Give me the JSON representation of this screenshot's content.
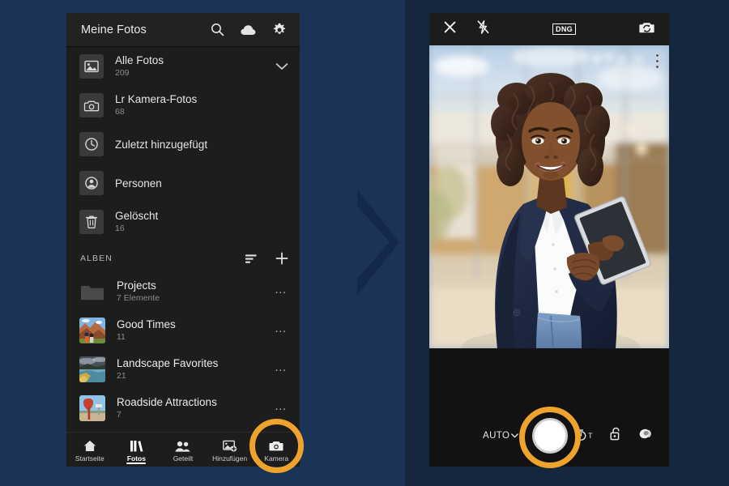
{
  "app": {
    "background_color": "#1a3356",
    "background_dark_color": "#16263d",
    "accent_color": "#eda32c"
  },
  "library": {
    "header": {
      "title": "Meine Fotos",
      "icons": [
        {
          "name": "search-icon",
          "label": "Suchen"
        },
        {
          "name": "cloud-icon",
          "label": "Cloud"
        },
        {
          "name": "gear-icon",
          "label": "Einstellungen"
        }
      ]
    },
    "categories": [
      {
        "name": "Alle Fotos",
        "count": "209",
        "icon": "photo-icon",
        "expandable": true
      },
      {
        "name": "Lr Kamera-Fotos",
        "count": "68",
        "icon": "camera-icon",
        "expandable": false
      },
      {
        "name": "Zuletzt hinzugefügt",
        "count": "",
        "icon": "clock-icon",
        "expandable": false
      },
      {
        "name": "Personen",
        "count": "",
        "icon": "person-icon",
        "expandable": false
      },
      {
        "name": "Gelöscht",
        "count": "16",
        "icon": "trash-icon",
        "expandable": false
      }
    ],
    "albums_section": {
      "label": "ALBEN",
      "actions": [
        {
          "name": "sort-icon",
          "label": "Sortieren"
        },
        {
          "name": "add-icon",
          "label": "Hinzufügen"
        }
      ]
    },
    "albums": [
      {
        "name": "Projects",
        "count": "7 Elemente",
        "thumb": "folder"
      },
      {
        "name": "Good Times",
        "count": "11",
        "thumb": "canyon-hikers"
      },
      {
        "name": "Landscape Favorites",
        "count": "21",
        "thumb": "lake-landscape"
      },
      {
        "name": "Roadside Attractions",
        "count": "7",
        "thumb": "red-sign"
      }
    ],
    "overflow_label": "…",
    "tabs": [
      {
        "label": "Startseite",
        "icon": "home-icon",
        "active": false
      },
      {
        "label": "Fotos",
        "icon": "library-icon",
        "active": true
      },
      {
        "label": "Geteilt",
        "icon": "people-icon",
        "active": false
      },
      {
        "label": "Hinzufügen",
        "icon": "add-photo-icon",
        "active": false
      },
      {
        "label": "Kamera",
        "icon": "camera-icon",
        "active": false,
        "highlighted": true
      }
    ]
  },
  "camera": {
    "header": {
      "close_icon": "close-icon",
      "flash_icon": "flash-off-icon",
      "format_badge": "DNG",
      "switch_icon": "switch-camera-icon"
    },
    "viewfinder": {
      "description": "Frau im dunkelblauen Blazer mit Tablet vor Glasfassade",
      "options_icon": "more-vertical-icon"
    },
    "controls": {
      "mode_label": "AUTO",
      "mode_chevron": "chevron-down-icon",
      "shutter": "shutter-button",
      "timer_label": "T",
      "timer_icon": "timer-icon",
      "lock_icon": "lock-open-icon",
      "preset_icon": "preset-icon"
    }
  }
}
